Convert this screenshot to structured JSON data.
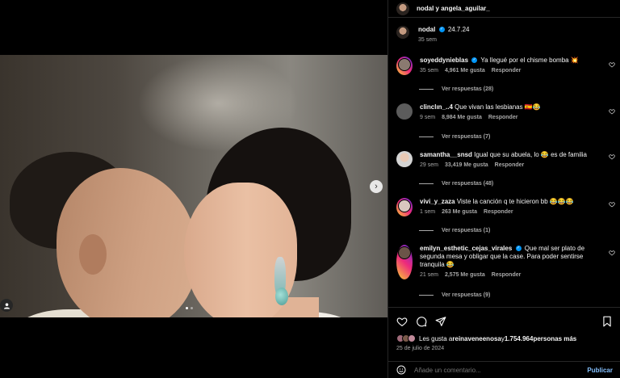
{
  "header": {
    "username": "nodal y angela_aguilar_"
  },
  "caption": {
    "username": "nodal",
    "date": "24.7.24",
    "age": "35 sem"
  },
  "comments": [
    {
      "username": "soyeddynieblas",
      "verified": true,
      "text": "Ya llegué por el chisme bomba 💥",
      "age": "35 sem",
      "likes": "4,961 Me gusta",
      "reply": "Responder",
      "view_replies": "Ver respuestas (28)"
    },
    {
      "username": "clinclın_..4",
      "verified": false,
      "text": "Que vivan las lesbianas 🇪🇸😂",
      "age": "9 sem",
      "likes": "8,984 Me gusta",
      "reply": "Responder",
      "view_replies": "Ver respuestas (7)"
    },
    {
      "username": "samantha__snsd",
      "verified": false,
      "text": "Igual que su abuela, lo 😂 es de familia",
      "age": "29 sem",
      "likes": "33,419 Me gusta",
      "reply": "Responder",
      "view_replies": "Ver respuestas (48)"
    },
    {
      "username": "vivi_y_zaza",
      "verified": false,
      "text": "Viste la canción q te hicieron bb 😂😂😂",
      "age": "1 sem",
      "likes": "263 Me gusta",
      "reply": "Responder",
      "view_replies": "Ver respuestas (1)"
    },
    {
      "username": "emilyn_esthetic_cejas_virales",
      "verified": true,
      "text": "Que mal ser plato de segunda mesa y obligar que la case. Para poder sentirse tranquila 😂",
      "age": "21 sem",
      "likes": "2,575 Me gusta",
      "reply": "Responder",
      "view_replies": "Ver respuestas (9)"
    }
  ],
  "likes": {
    "prefix": "Les gusta a ",
    "user": "reinaveneenosa",
    "middle": " y ",
    "count": "1.754.964",
    "suffix": " personas más"
  },
  "post_date": "25 de julio de 2024",
  "add_comment": {
    "placeholder": "Añade un comentario...",
    "post_label": "Publicar"
  },
  "colors": {
    "verified": "#0095f6",
    "link": "#85c1ff",
    "muted": "#a8a8a8"
  },
  "icons": [
    "heart-icon",
    "comment-icon",
    "share-icon",
    "bookmark-icon",
    "emoji-icon",
    "chevron-right-icon",
    "person-tag-icon"
  ]
}
